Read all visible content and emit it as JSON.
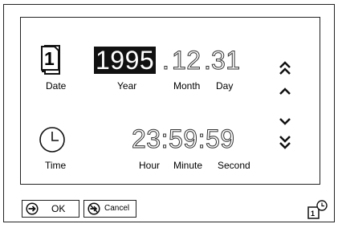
{
  "date": {
    "icon_text": "1",
    "label": "Date",
    "year": "1995",
    "sep1": ".",
    "month": "12",
    "sep2": ".",
    "day": "31",
    "year_label": "Year",
    "month_label": "Month",
    "day_label": "Day"
  },
  "time": {
    "label": "Time",
    "value": "23:59:59",
    "hour_label": "Hour",
    "minute_label": "Minute",
    "second_label": "Second"
  },
  "icons": {
    "date_icon": "calendar-icon",
    "time_icon": "clock-icon",
    "fast_up": "double-chevron-up-icon",
    "up": "chevron-up-icon",
    "down": "chevron-down-icon",
    "fast_down": "double-chevron-down-icon",
    "ok": "circle-arrow-icon",
    "cancel": "cancel-circle-icon",
    "corner": "calendar-clock-icon"
  },
  "buttons": {
    "ok_label": "OK",
    "cancel_label": "Cancel"
  }
}
